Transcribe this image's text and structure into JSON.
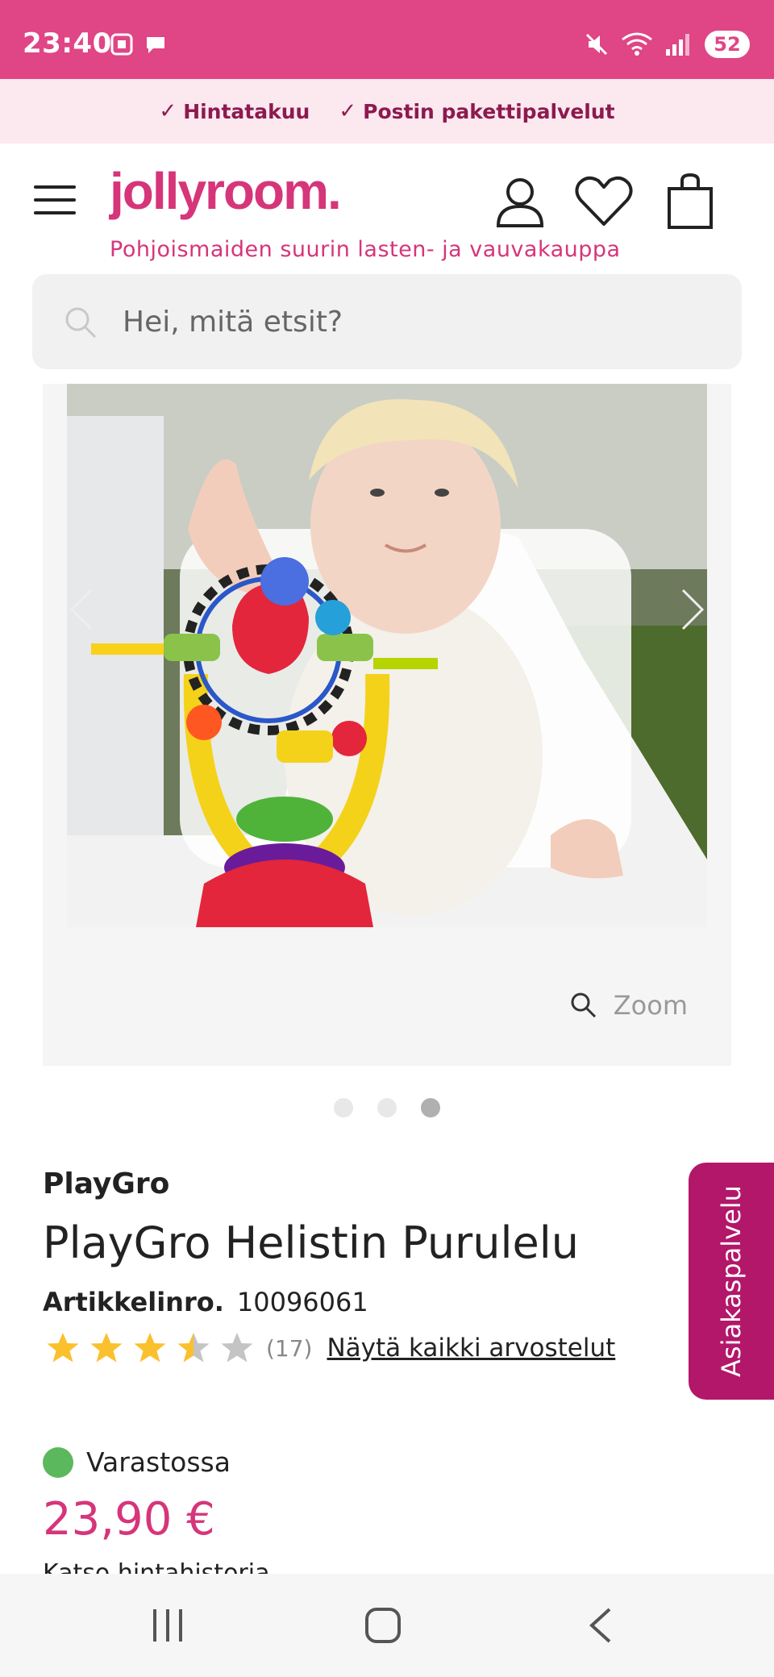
{
  "status_bar": {
    "time": "23:40",
    "battery": "52"
  },
  "usp": {
    "items": [
      "Hintatakuu",
      "Postin pakettipalvelut"
    ]
  },
  "header": {
    "logo": "jollyroom.",
    "tagline": "Pohjoismaiden suurin lasten- ja vauvakauppa"
  },
  "search": {
    "placeholder": "Hei, mitä etsit?"
  },
  "gallery": {
    "zoom_label": "Zoom",
    "image_count": 3,
    "active_index": 2
  },
  "product": {
    "brand": "PlayGro",
    "title": "PlayGro Helistin Purulelu",
    "sku_label": "Artikkelinro.",
    "sku": "10096061",
    "rating": 3.5,
    "rating_count": "(17)",
    "reviews_link": "Näytä kaikki arvostelut",
    "stock": "Varastossa",
    "price": "23,90 €",
    "price_history": "Katso hintahistoria"
  },
  "side_tab": {
    "label": "Asiakaspalvelu"
  },
  "colors": {
    "brand": "#d6357a",
    "status_bar": "#e04585",
    "usp_bg": "#fce8ef",
    "in_stock": "#5cb85c",
    "side_tab": "#b3176a",
    "star": "#fbc02d"
  }
}
